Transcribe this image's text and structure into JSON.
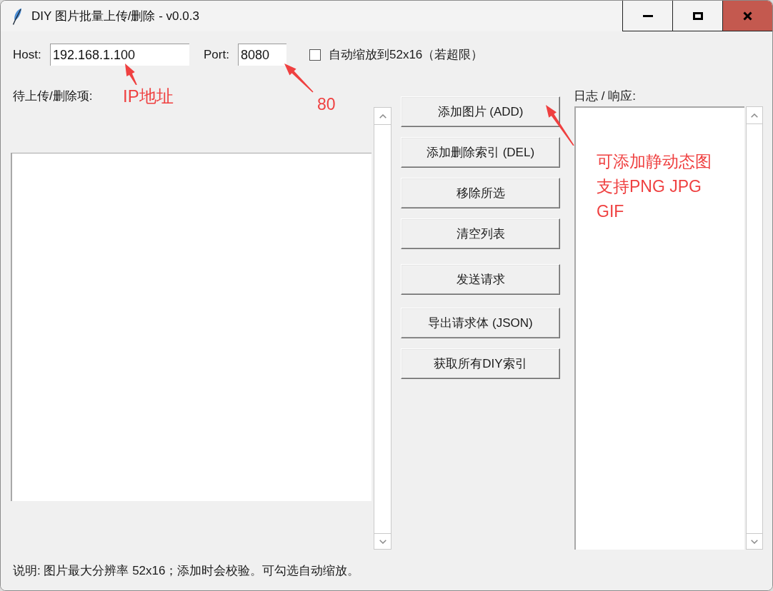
{
  "window": {
    "title": "DIY 图片批量上传/删除 - v0.0.3"
  },
  "connection": {
    "host": {
      "label": "Host:",
      "value": "192.168.1.100"
    },
    "port": {
      "label": "Port:",
      "value": "8080"
    },
    "auto_scale": {
      "label": "自动缩放到52x16（若超限）",
      "checked": false
    }
  },
  "queue": {
    "label": "待上传/删除项:"
  },
  "buttons": [
    "添加图片 (ADD)",
    "添加删除索引 (DEL)",
    "移除所选",
    "清空列表",
    "发送请求",
    "导出请求体 (JSON)",
    "获取所有DIY索引"
  ],
  "log": {
    "label": "日志 / 响应:"
  },
  "note": "说明: 图片最大分辨率 52x16；添加时会校验。可勾选自动缩放。",
  "annotations": [
    {
      "lines": [
        "IP地址"
      ]
    },
    {
      "lines": [
        "80"
      ]
    },
    {
      "lines": [
        "可添加静动态图",
        "支持PNG JPG",
        "GIF"
      ]
    }
  ]
}
